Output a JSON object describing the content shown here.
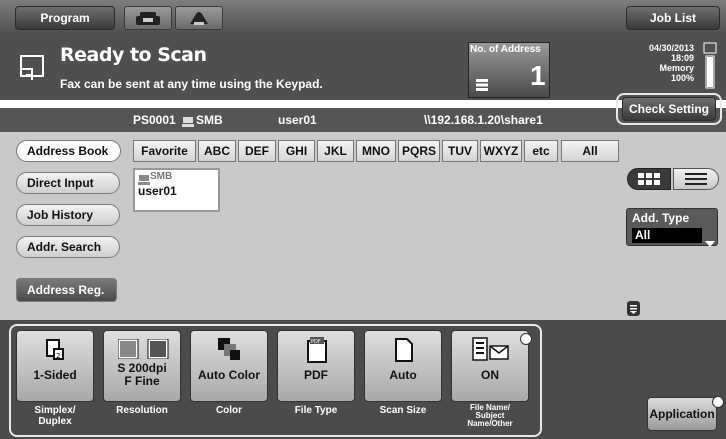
{
  "header": {
    "program_label": "Program",
    "job_list_label": "Job List"
  },
  "status": {
    "title": "Ready to Scan",
    "subtitle": "Fax can be sent at any time using the Keypad.",
    "address_count_label": "No. of Address",
    "address_count": "1",
    "date": "04/30/2013",
    "time": "18:09",
    "memory_label": "Memory",
    "memory_value": "100%",
    "check_setting_label": "Check Setting"
  },
  "destination": {
    "id": "PS0001",
    "type": "SMB",
    "user": "user01",
    "path": "\\\\192.168.1.20\\share1"
  },
  "sidebar": {
    "items": [
      {
        "label": "Address Book"
      },
      {
        "label": "Direct Input"
      },
      {
        "label": "Job History"
      },
      {
        "label": "Addr. Search"
      },
      {
        "label": "Address Reg."
      }
    ]
  },
  "tabs": [
    "Favorite",
    "ABC",
    "DEF",
    "GHI",
    "JKL",
    "MNO",
    "PQRS",
    "TUV",
    "WXYZ",
    "etc",
    "All"
  ],
  "entry": {
    "type": "SMB",
    "name": "user01"
  },
  "add_type": {
    "label": "Add. Type",
    "value": "All"
  },
  "functions": [
    {
      "value": "1-Sided",
      "caption": "Simplex/\nDuplex",
      "icon": "simplex-icon"
    },
    {
      "value": "S 200dpi\nF Fine",
      "caption": "Resolution",
      "icon": "resolution-icon"
    },
    {
      "value": "Auto Color",
      "caption": "Color",
      "icon": "color-icon"
    },
    {
      "value": "PDF",
      "caption": "File Type",
      "icon": "pdf-icon"
    },
    {
      "value": "Auto",
      "caption": "Scan Size",
      "icon": "page-icon"
    },
    {
      "value": "ON",
      "caption": "File Name/\nSubject\nName/Other",
      "icon": "document-mail-icon"
    }
  ],
  "application_label": "Application"
}
